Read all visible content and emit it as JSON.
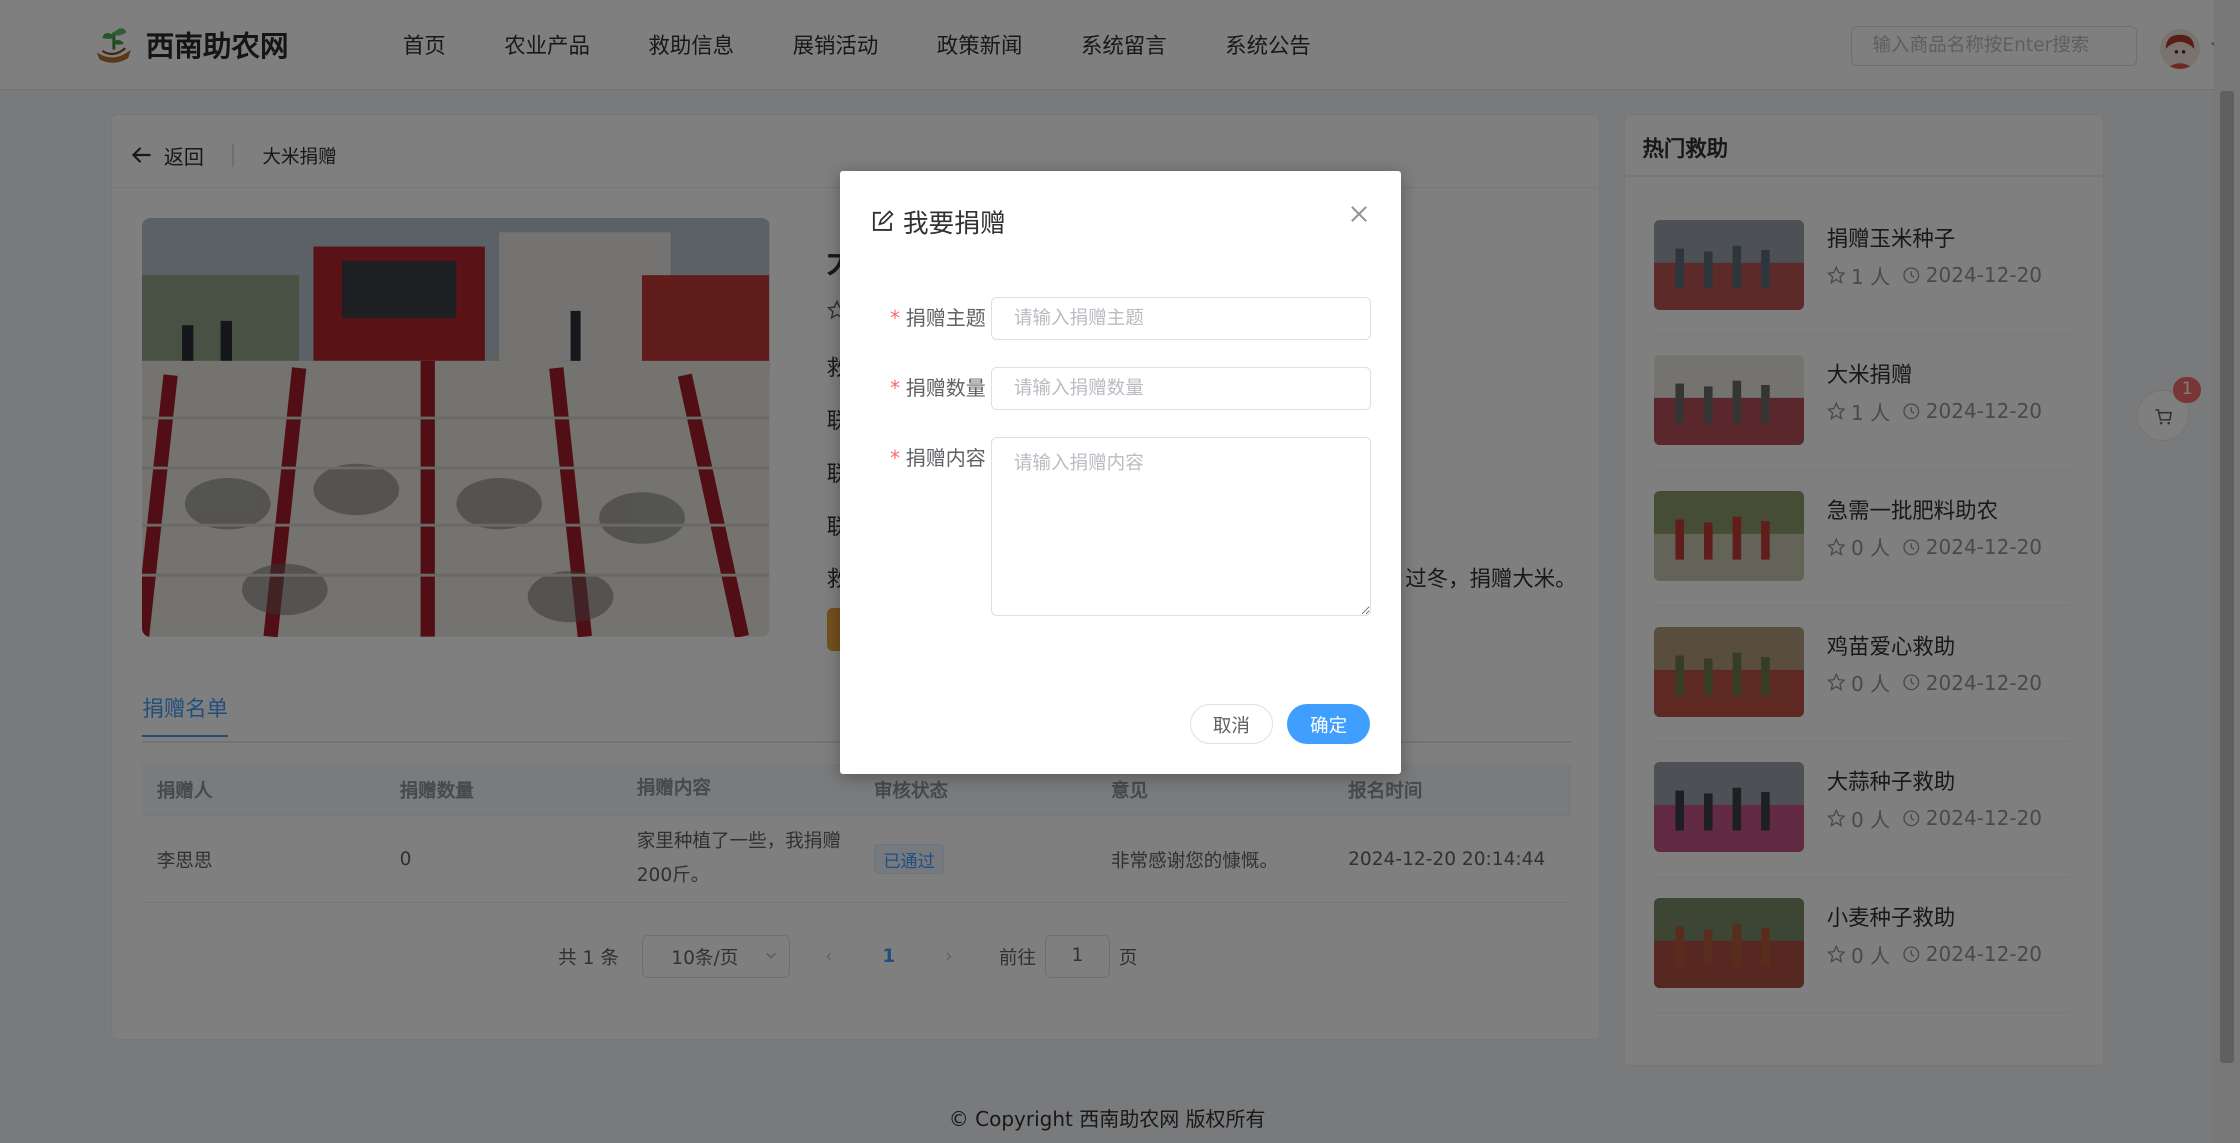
{
  "brand": {
    "name": "西南助农网"
  },
  "nav": [
    "首页",
    "农业产品",
    "救助信息",
    "展销活动",
    "政策新闻",
    "系统留言",
    "系统公告"
  ],
  "search": {
    "placeholder": "输入商品名称按Enter搜索"
  },
  "detail": {
    "back_label": "返回",
    "breadcrumb": "大米捐赠",
    "title_partial": "大",
    "row_prefixes": [
      "救",
      "联",
      "联",
      "联",
      "救"
    ],
    "content_tail": "过冬，捐赠大米。"
  },
  "tabs": {
    "active": "捐赠名单"
  },
  "table": {
    "headers": [
      "捐赠人",
      "捐赠数量",
      "捐赠内容",
      "审核状态",
      "意见",
      "报名时间"
    ],
    "rows": [
      {
        "donor": "李思思",
        "quantity": "0",
        "content": "家里种植了一些，我捐赠200斤。",
        "status": "已通过",
        "opinion": "非常感谢您的慷慨。",
        "time": "2024-12-20 20:14:44"
      }
    ]
  },
  "pagination": {
    "total": "共 1 条",
    "page_size": "10条/页",
    "current": "1",
    "goto_label": "前往",
    "goto_value": "1",
    "page_suffix": "页"
  },
  "hot": {
    "title": "热门救助",
    "items": [
      {
        "title": "捐赠玉米种子",
        "people": "1 人",
        "date": "2024-12-20"
      },
      {
        "title": "大米捐赠",
        "people": "1 人",
        "date": "2024-12-20"
      },
      {
        "title": "急需一批肥料助农",
        "people": "0 人",
        "date": "2024-12-20"
      },
      {
        "title": "鸡苗爱心救助",
        "people": "0 人",
        "date": "2024-12-20"
      },
      {
        "title": "大蒜种子救助",
        "people": "0 人",
        "date": "2024-12-20"
      },
      {
        "title": "小麦种子救助",
        "people": "0 人",
        "date": "2024-12-20"
      }
    ]
  },
  "cart": {
    "badge": "1"
  },
  "footer": "© Copyright 西南助农网 版权所有",
  "dialog": {
    "title": "我要捐赠",
    "fields": [
      {
        "label": "捐赠主题",
        "placeholder": "请输入捐赠主题"
      },
      {
        "label": "捐赠数量",
        "placeholder": "请输入捐赠数量"
      },
      {
        "label": "捐赠内容",
        "placeholder": "请输入捐赠内容"
      }
    ],
    "cancel": "取消",
    "confirm": "确定"
  },
  "colors": {
    "primary": "#409eff",
    "warning": "#e6a23c",
    "danger": "#f56c6c"
  }
}
